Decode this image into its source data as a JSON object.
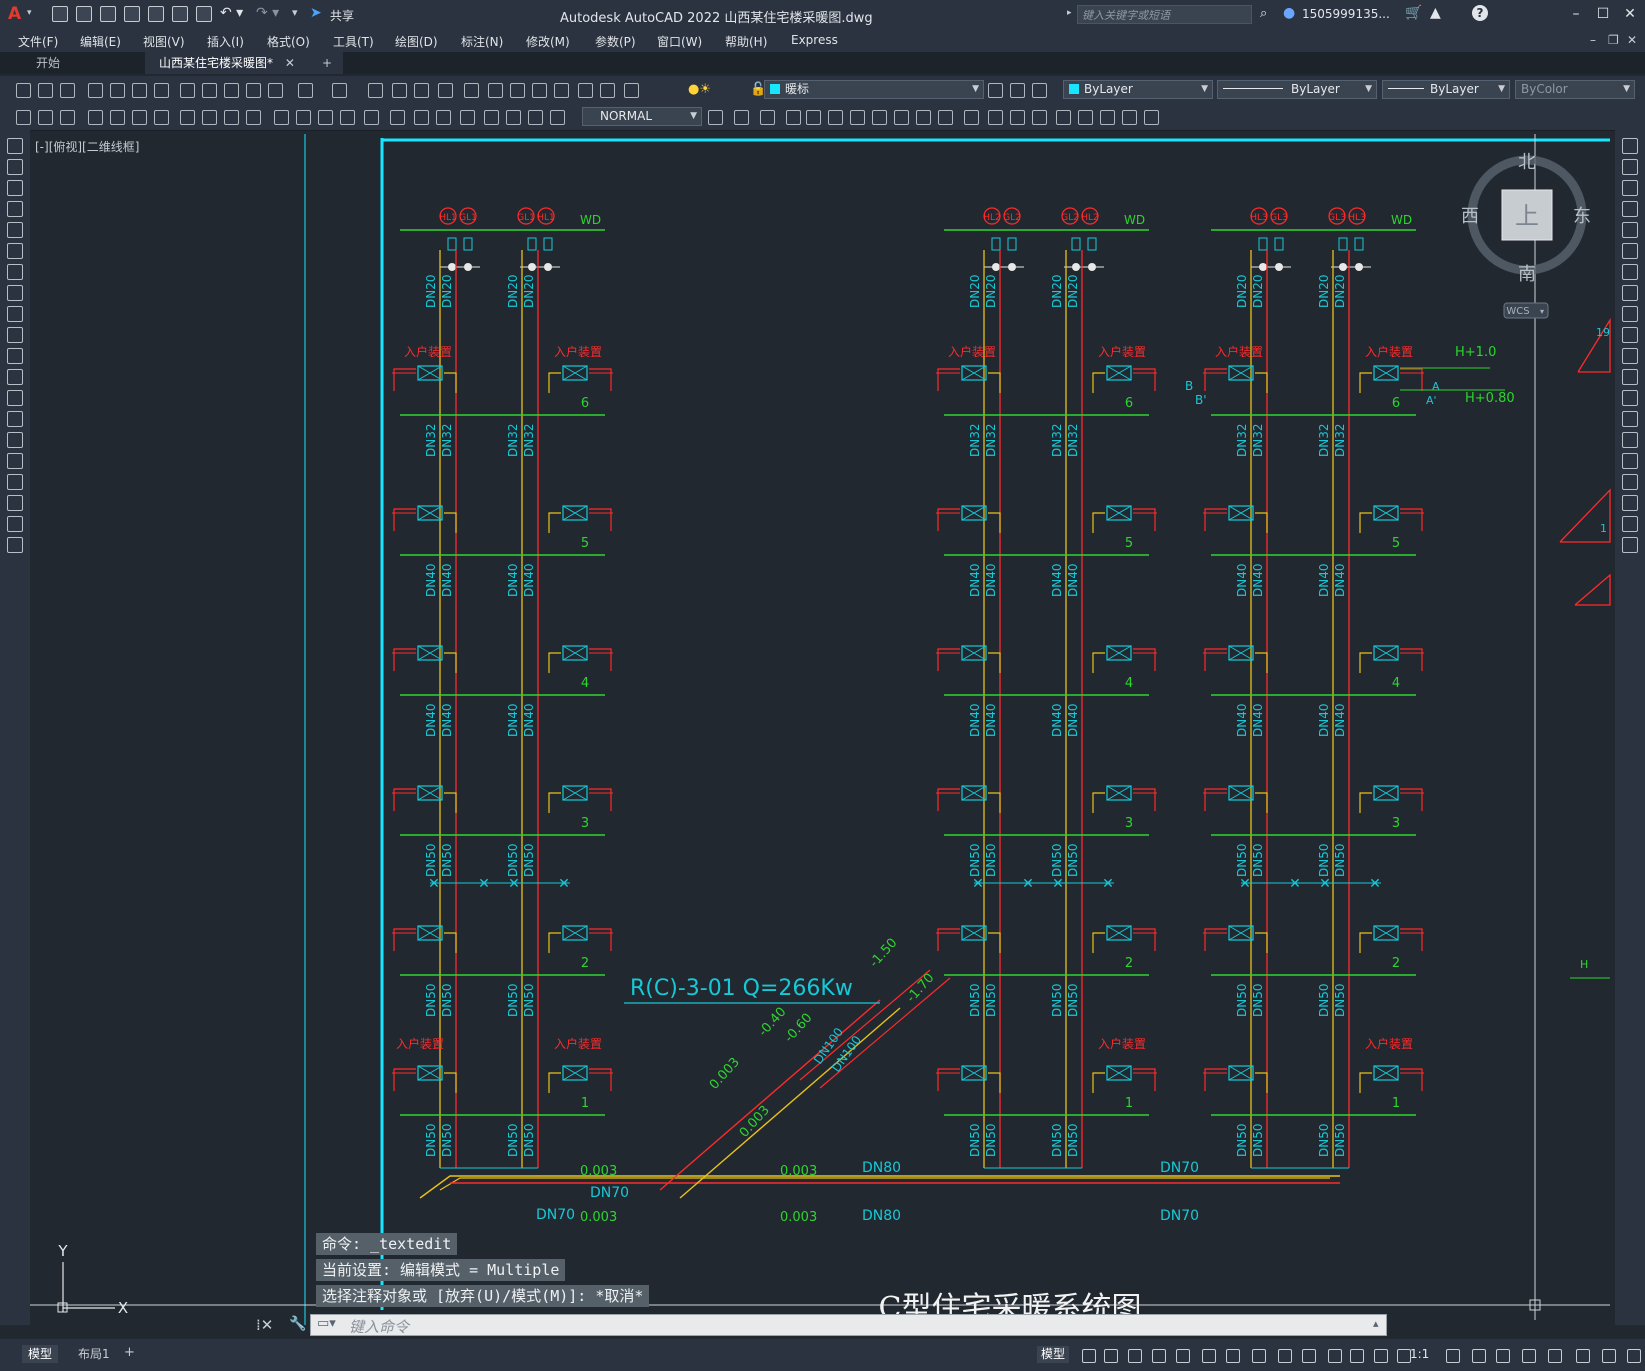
{
  "app": {
    "title": "Autodesk AutoCAD 2022    山西某住宅楼采暖图.dwg",
    "logo": "A",
    "share_label": "共享",
    "search_placeholder": "键入关键字或短语",
    "user": "1505999135...",
    "help": "?"
  },
  "menus": [
    "文件(F)",
    "编辑(E)",
    "视图(V)",
    "插入(I)",
    "格式(O)",
    "工具(T)",
    "绘图(D)",
    "标注(N)",
    "修改(M)",
    "参数(P)",
    "窗口(W)",
    "帮助(H)",
    "Express"
  ],
  "tabs": {
    "start": "开始",
    "active": "山西某住宅楼采暖图*",
    "close": "✕",
    "add": "+"
  },
  "properties": {
    "layer": "暖标",
    "color": "ByLayer",
    "linetype": "ByLayer",
    "lineweight": "ByLayer",
    "plotstyle": "ByColor",
    "dimstyle": "NORMAL"
  },
  "viewport_label": "[-][俯视][二维线框]",
  "viewcube": {
    "north": "北",
    "south": "南",
    "east": "东",
    "west": "西",
    "top": "上",
    "wcs": "WCS"
  },
  "drawing": {
    "title": "C型住宅采暖系统图",
    "system_label": "R(C)-3-01  Q=266Kw",
    "riser_labels": [
      [
        "HL1",
        "GL1",
        "GL1",
        "HL1"
      ],
      [
        "HL2",
        "GL2",
        "GL2",
        "HL2"
      ],
      [
        "HL3",
        "GL3",
        "GL3",
        "HL3"
      ]
    ],
    "wd": "WD",
    "entry": "入户装置",
    "floors": [
      "6",
      "5",
      "4",
      "3",
      "2",
      "1"
    ],
    "pipe_sizes": {
      "top": "DN20",
      "f6": "DN32",
      "f5": "DN40",
      "f4": "DN40",
      "f3": "DN50",
      "f2": "DN50",
      "f1": "DN50"
    },
    "supply_labels": [
      "DN70",
      "DN80",
      "DN70"
    ],
    "return_labels": [
      "DN70",
      "DN80",
      "DN70"
    ],
    "slopes": [
      "0.003",
      "0.003",
      "0.003",
      "0.003",
      "0.003",
      "0.003"
    ],
    "main_dn": [
      "DN100",
      "DN100"
    ],
    "elevations": [
      "-1.50",
      "-1.70",
      "-0.40",
      "-0.60"
    ],
    "right_marks": {
      "h1": "H+1.0",
      "h2": "H+0.80",
      "a": "A",
      "a2": "A'",
      "b": "B",
      "b2": "B'",
      "n19": "19",
      "h": "H",
      "n1": "1"
    }
  },
  "ucs": {
    "x": "X",
    "y": "Y"
  },
  "command": {
    "history": [
      "命令:  _textedit",
      "当前设置: 编辑模式 = Multiple",
      "选择注释对象或 [放弃(U)/模式(M)]: *取消*"
    ],
    "placeholder": "键入命令"
  },
  "layout_tabs": [
    "模型",
    "布局1",
    "+"
  ],
  "status": {
    "model": "模型",
    "scale": "1:1"
  },
  "colors": {
    "background": "#212830",
    "supply": "#ff2a2a",
    "return": "#e8c21a",
    "text_cyan": "#18c8d6",
    "green": "#2ed52e",
    "frame_cyan": "#18e6ff"
  }
}
